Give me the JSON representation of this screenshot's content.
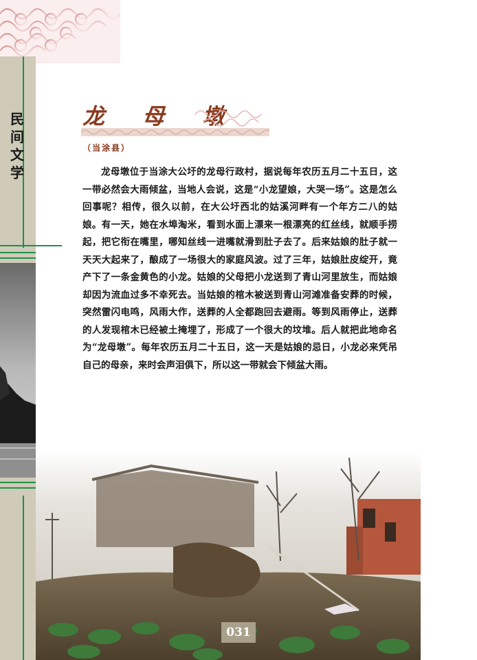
{
  "sidebar": {
    "chars": [
      "民",
      "间",
      "文",
      "学"
    ]
  },
  "article": {
    "title": "龙 母 墩",
    "subtitle": "（当涂县）",
    "body": "龙母墩位于当涂大公圩的龙母行政村，据说每年农历五月二十五日，这一带必然会大雨倾盆，当地人会说，这是“小龙望娘，大哭一场”。这是怎么回事呢？相传，很久以前，在大公圩西北的姑溪河畔有一个年方二八的姑娘。有一天，她在水埠淘米，看到水面上漂来一根漂亮的红丝线，就顺手捞起，把它衔在嘴里，哪知丝线一进嘴就滑到肚子去了。后来姑娘的肚子就一天天大起来了，酿成了一场很大的家庭风波。过了三年，姑娘肚皮绽开，竟产下了一条金黄色的小龙。姑娘的父母把小龙送到了青山河里放生，而姑娘却因为流血过多不幸死去。当姑娘的棺木被送到青山河滩准备安葬的时候，突然雷闪电鸣，风雨大作，送葬的人全都跑回去避雨。等到风雨停止，送葬的人发现棺木已经被土掩埋了，形成了一个很大的坟堆。后人就把此地命名为“龙母墩”。每年农历五月二十五日，这一天是姑娘的忌日，小龙必来凭吊自己的母亲，来时会声泪俱下，所以这一带就会下倾盆大雨。"
  },
  "page_number": "031",
  "colors": {
    "accent_green": "#1f8f4a",
    "title_brown": "#8a3a1e",
    "sidebar_bg": "#cfcbb8"
  }
}
